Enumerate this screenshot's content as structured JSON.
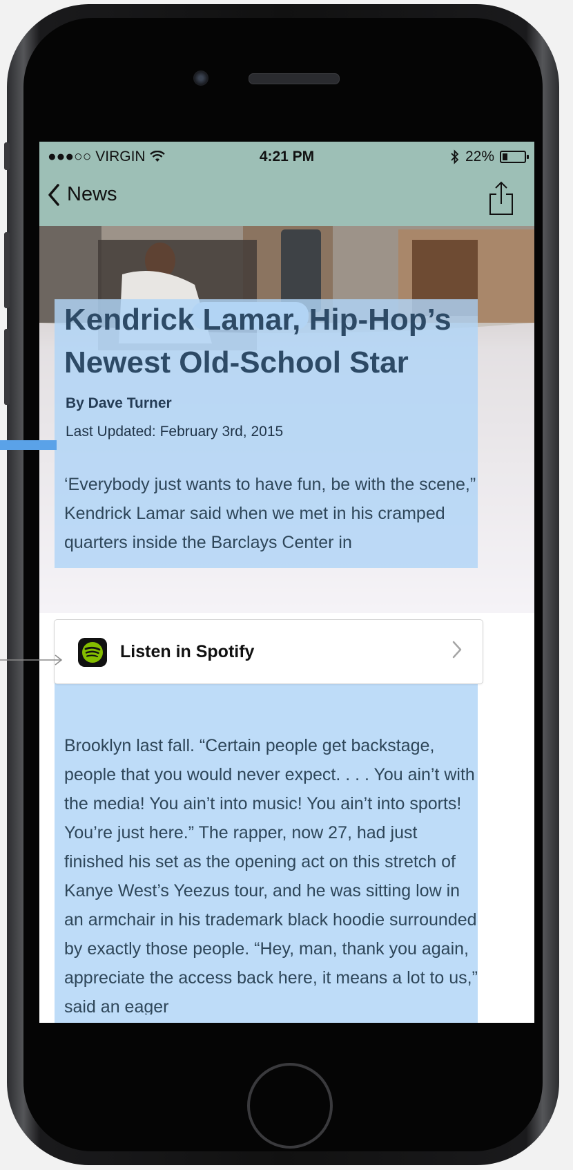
{
  "status_bar": {
    "carrier": "●●●○○ VIRGIN",
    "time": "4:21 PM",
    "battery": "22%",
    "battery_level": 0.22
  },
  "nav": {
    "back_label": "News"
  },
  "article": {
    "title": "Kendrick Lamar, Hip-Hop’s Newest Old-School Star",
    "author": "By Dave Turner",
    "updated": "Last Updated: February 3rd, 2015",
    "paragraph_1": "‘Everybody just wants to have fun, be with the scene,” Kendrick Lamar said when we met in his cramped quarters inside the Barclays Center in",
    "paragraph_2": "Brooklyn last fall. “Certain people get backstage, people that you would never expect. . . . You ain’t with the media! You ain’t into music! You ain’t into sports! You’re just here.” The rapper, now 27, had just finished his set as the opening act on this stretch of Kanye West’s Yeezus tour, and he was sitting low in an armchair in his trademark black hoodie surrounded by exactly those people. “Hey, man, thank you again, appreciate the access back here, it means a lot to us,” said an eager"
  },
  "spotify": {
    "label": "Listen in Spotify"
  },
  "colors": {
    "nav_background": "#9dbfb6",
    "highlight": "#b0d4f6",
    "annotation": "#5aa2e8",
    "spotify_green": "#84bd00"
  },
  "icons": [
    "wifi-icon",
    "bluetooth-icon",
    "battery-icon",
    "back-chevron-icon",
    "share-icon",
    "spotify-icon",
    "chevron-right-icon"
  ]
}
